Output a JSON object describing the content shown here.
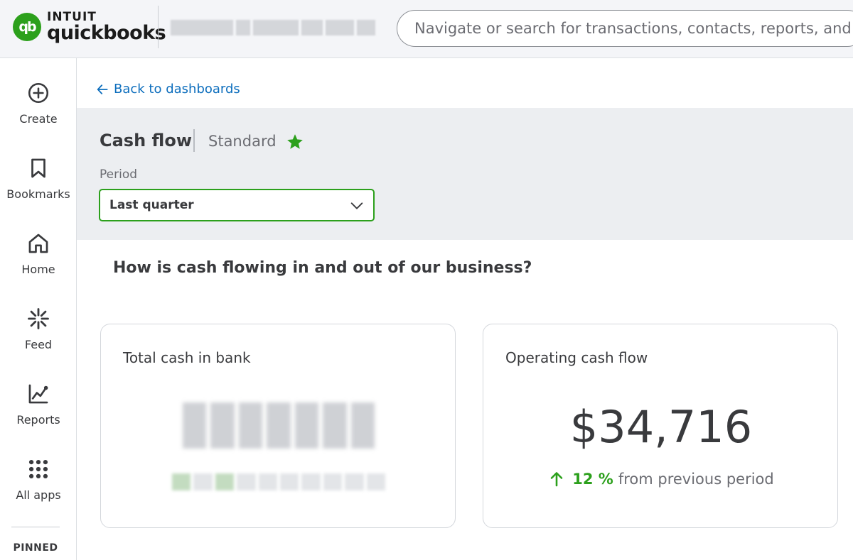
{
  "brand": {
    "intuit_text": "INTUIT",
    "product_text": "quickbooks",
    "logo_glyph": "qb",
    "color": "#2ca01c"
  },
  "search": {
    "placeholder": "Navigate or search for transactions, contacts, reports, and m"
  },
  "sidebar": {
    "items": [
      {
        "label": "Create",
        "icon": "plus-circle-icon"
      },
      {
        "label": "Bookmarks",
        "icon": "bookmark-icon"
      },
      {
        "label": "Home",
        "icon": "home-icon"
      },
      {
        "label": "Feed",
        "icon": "sparkle-icon"
      },
      {
        "label": "Reports",
        "icon": "line-chart-icon"
      },
      {
        "label": "All apps",
        "icon": "grid-dots-icon"
      }
    ],
    "pinned_label": "PINNED"
  },
  "main": {
    "back_label": "Back to dashboards",
    "dashboard_title": "Cash flow",
    "dashboard_subtitle": "Standard",
    "period_label": "Period",
    "period_value": "Last quarter",
    "question": "How is cash flowing in and out of our business?",
    "cards": [
      {
        "title": "Total cash in bank",
        "value_redacted": true
      },
      {
        "title": "Operating cash flow",
        "value": "$34,716",
        "trend_pct": "12 %",
        "trend_text": "from previous period",
        "trend_direction": "up"
      }
    ]
  },
  "colors": {
    "accent": "#2ca01c",
    "link": "#0d6ebd",
    "text": "#393a3d",
    "muted": "#6b6c72"
  }
}
